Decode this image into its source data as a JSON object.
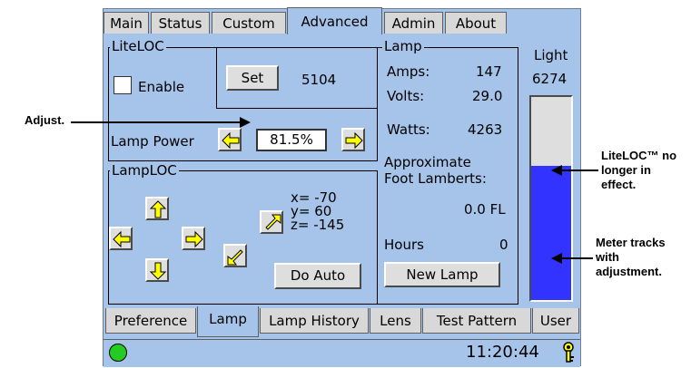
{
  "tabs_top": [
    "Main",
    "Status",
    "Custom",
    "Advanced",
    "Admin",
    "About"
  ],
  "tabs_top_active": "Advanced",
  "liteloc": {
    "title": "LiteLOC",
    "enable_label": "Enable",
    "set_label": "Set",
    "set_value": "5104",
    "lamp_power_label": "Lamp Power",
    "lamp_power_value": "81.5%"
  },
  "lamploc": {
    "title": "LampLOC",
    "x": "x= -70",
    "y": "y= 60",
    "z": "z= -145",
    "do_auto_label": "Do Auto"
  },
  "lamp": {
    "title": "Lamp",
    "amps_label": "Amps:",
    "amps_value": "147",
    "volts_label": "Volts:",
    "volts_value": "29.0",
    "watts_label": "Watts:",
    "watts_value": "4263",
    "approx_line1": "Approximate",
    "approx_line2": "Foot Lamberts:",
    "fl_value": "0.0 FL",
    "hours_label": "Hours",
    "hours_value": "0",
    "new_lamp_label": "New Lamp"
  },
  "light": {
    "label": "Light",
    "value": "6274",
    "meter_fraction": 0.66,
    "meter_color": "#3333ff"
  },
  "tabs_bottom": [
    "Preference",
    "Lamp",
    "Lamp History",
    "Lens",
    "Test Pattern",
    "User"
  ],
  "tabs_bottom_active": "Lamp",
  "status": {
    "time": "11:20:44",
    "led_color": "#22cc22"
  },
  "annotations": {
    "adjust": "Adjust.",
    "liteloc_line1": "LiteLOC™ no",
    "liteloc_line2": "longer in",
    "liteloc_line3": "effect.",
    "meter_line1": "Meter tracks",
    "meter_line2": "with",
    "meter_line3": "adjustment."
  }
}
